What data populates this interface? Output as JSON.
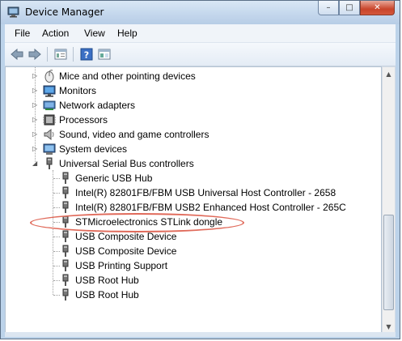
{
  "window": {
    "title": "Device Manager",
    "controls": {
      "minimize": "–",
      "maximize": "□",
      "close": "✕"
    }
  },
  "menu": [
    "File",
    "Action",
    "View",
    "Help"
  ],
  "toolbar": {
    "icons": [
      "back-arrow-icon",
      "forward-arrow-icon",
      "properties-icon",
      "help-icon",
      "show-hide-icon"
    ]
  },
  "tree": {
    "categories": [
      {
        "label": "Mice and other pointing devices",
        "icon": "mouse-icon",
        "expanded": false
      },
      {
        "label": "Monitors",
        "icon": "monitor-icon",
        "expanded": false
      },
      {
        "label": "Network adapters",
        "icon": "network-icon",
        "expanded": false
      },
      {
        "label": "Processors",
        "icon": "processor-icon",
        "expanded": false
      },
      {
        "label": "Sound, video and game controllers",
        "icon": "speaker-icon",
        "expanded": false
      },
      {
        "label": "System devices",
        "icon": "system-icon",
        "expanded": false
      },
      {
        "label": "Universal Serial Bus controllers",
        "icon": "usb-icon",
        "expanded": true
      }
    ],
    "usb_devices": [
      "Generic USB Hub",
      "Intel(R) 82801FB/FBM USB Universal Host Controller - 2658",
      "Intel(R) 82801FB/FBM USB2 Enhanced Host Controller - 265C",
      "STMicroelectronics STLink dongle",
      "USB Composite Device",
      "USB Composite Device",
      "USB Printing Support",
      "USB Root Hub",
      "USB Root Hub"
    ],
    "highlighted_device_index": 3
  },
  "colors": {
    "highlight": "#e06a5a",
    "titlebar": "#c3d6ec"
  }
}
